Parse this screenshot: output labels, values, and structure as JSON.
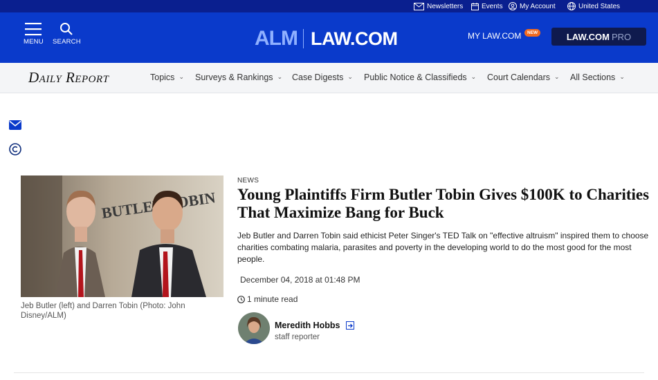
{
  "utility": {
    "newsletters": "Newsletters",
    "events": "Events",
    "account": "My Account",
    "region": "United States"
  },
  "header": {
    "menu_label": "MENU",
    "search_label": "SEARCH",
    "logo_alm": "ALM",
    "logo_law": "LAW.COM",
    "mylaw_label": "MY LAW.COM",
    "new_badge": "NEW",
    "pro_law": "LAW.COM",
    "pro_suffix": "PRO"
  },
  "nav": {
    "brand": "Daily Report",
    "items": [
      {
        "label": "Topics"
      },
      {
        "label": "Surveys & Rankings"
      },
      {
        "label": "Case Digests"
      },
      {
        "label": "Public Notice & Classifieds"
      },
      {
        "label": "Court Calendars"
      },
      {
        "label": "All Sections"
      }
    ]
  },
  "article": {
    "kicker": "NEWS",
    "headline": "Young Plaintiffs Firm Butler Tobin Gives $100K to Charities That Maximize Bang for Buck",
    "dek": "Jeb Butler and Darren Tobin said ethicist Peter Singer's TED Talk on \"effective altruism\" inspired them to choose charities combating malaria, parasites and poverty in the developing world to do the most good for the most people.",
    "date": "December 04, 2018 at 01:48 PM",
    "read_time": "1 minute read",
    "photo_sign": "BUTLER|TOBIN",
    "photo_caption": "Jeb Butler (left) and Darren Tobin (Photo: John Disney/ALM)",
    "author_name": "Meredith Hobbs",
    "author_title": "staff reporter"
  },
  "colors": {
    "utility_bg": "#0a1f8f",
    "header_bg": "#0a3acb",
    "pro_bg": "#0f1a4e",
    "badge": "#f26b1f",
    "nav_bg": "#f4f5f7"
  }
}
